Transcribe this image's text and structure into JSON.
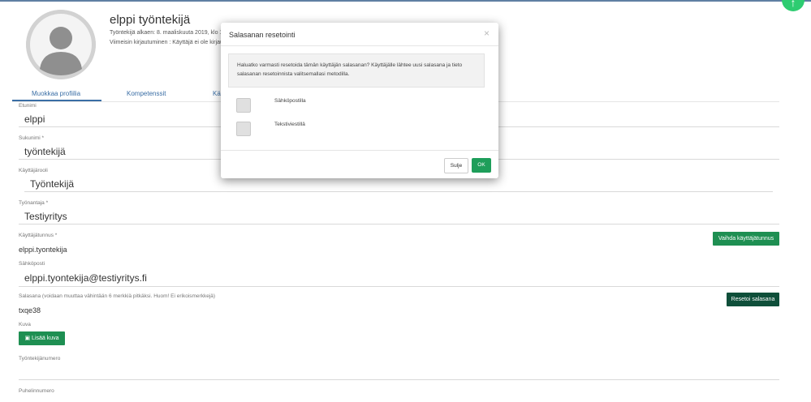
{
  "profile": {
    "name": "elppi työntekijä",
    "employee_since": "Työntekijä alkaen: 8. maaliskuuta 2019, klo 12",
    "last_login": "Viimeisin kirjautuminen : Käyttäjä ei ole kirjau"
  },
  "tabs": [
    {
      "label": "Muokkaa profiilia"
    },
    {
      "label": "Kompetenssit"
    },
    {
      "label": "Kä"
    }
  ],
  "fields": {
    "first_name": {
      "label": "Etunimi",
      "value": "elppi"
    },
    "last_name": {
      "label": "Sukunimi *",
      "value": "työntekijä"
    },
    "role": {
      "label": "Käyttäjärooli",
      "value": "Työntekijä"
    },
    "employer": {
      "label": "Työnantaja *",
      "value": "Testiyritys"
    },
    "username": {
      "label": "Käyttäjätunnus *",
      "value": "elppi.tyontekija"
    },
    "email": {
      "label": "Sähköposti",
      "value": "elppi.tyontekija@testiyritys.fi"
    },
    "password": {
      "label": "Salasana (voidaan muuttaa vähintään 6 merkkiä pitkäksi. Huom! Ei erikoismerkkejä)",
      "value": "txqe38"
    },
    "image": {
      "label": "Kuva"
    },
    "employee_number": {
      "label": "Työntekijänumero"
    },
    "phone": {
      "label": "Puhelinnumero"
    }
  },
  "buttons": {
    "change_username": "Vaihda käyttäjätunnus",
    "reset_password": "Resetoi salasana",
    "add_image": "Lisää kuva"
  },
  "modal": {
    "title": "Salasanan resetointi",
    "close_symbol": "×",
    "info_line1": "Haluatko varmasti resetoida tämän käyttäjän salasanan? Käyttäjälle lähtee uusi salasana ja tieto",
    "info_line2": "salasanan resetoinnista valitsemallasi metodilla.",
    "options": [
      {
        "label": "Sähköpostilla"
      },
      {
        "label": "Tekstiviestillä"
      }
    ],
    "cancel_label": "Sulje",
    "ok_label": "OK"
  },
  "colors": {
    "primary_green": "#1e8f52",
    "accent_blue": "#3a6ea5",
    "fab_green": "#2ecc71"
  },
  "icons": {
    "avatar": "user-silhouette-icon",
    "camera": "camera-icon",
    "fab": "floating-action-icon"
  }
}
